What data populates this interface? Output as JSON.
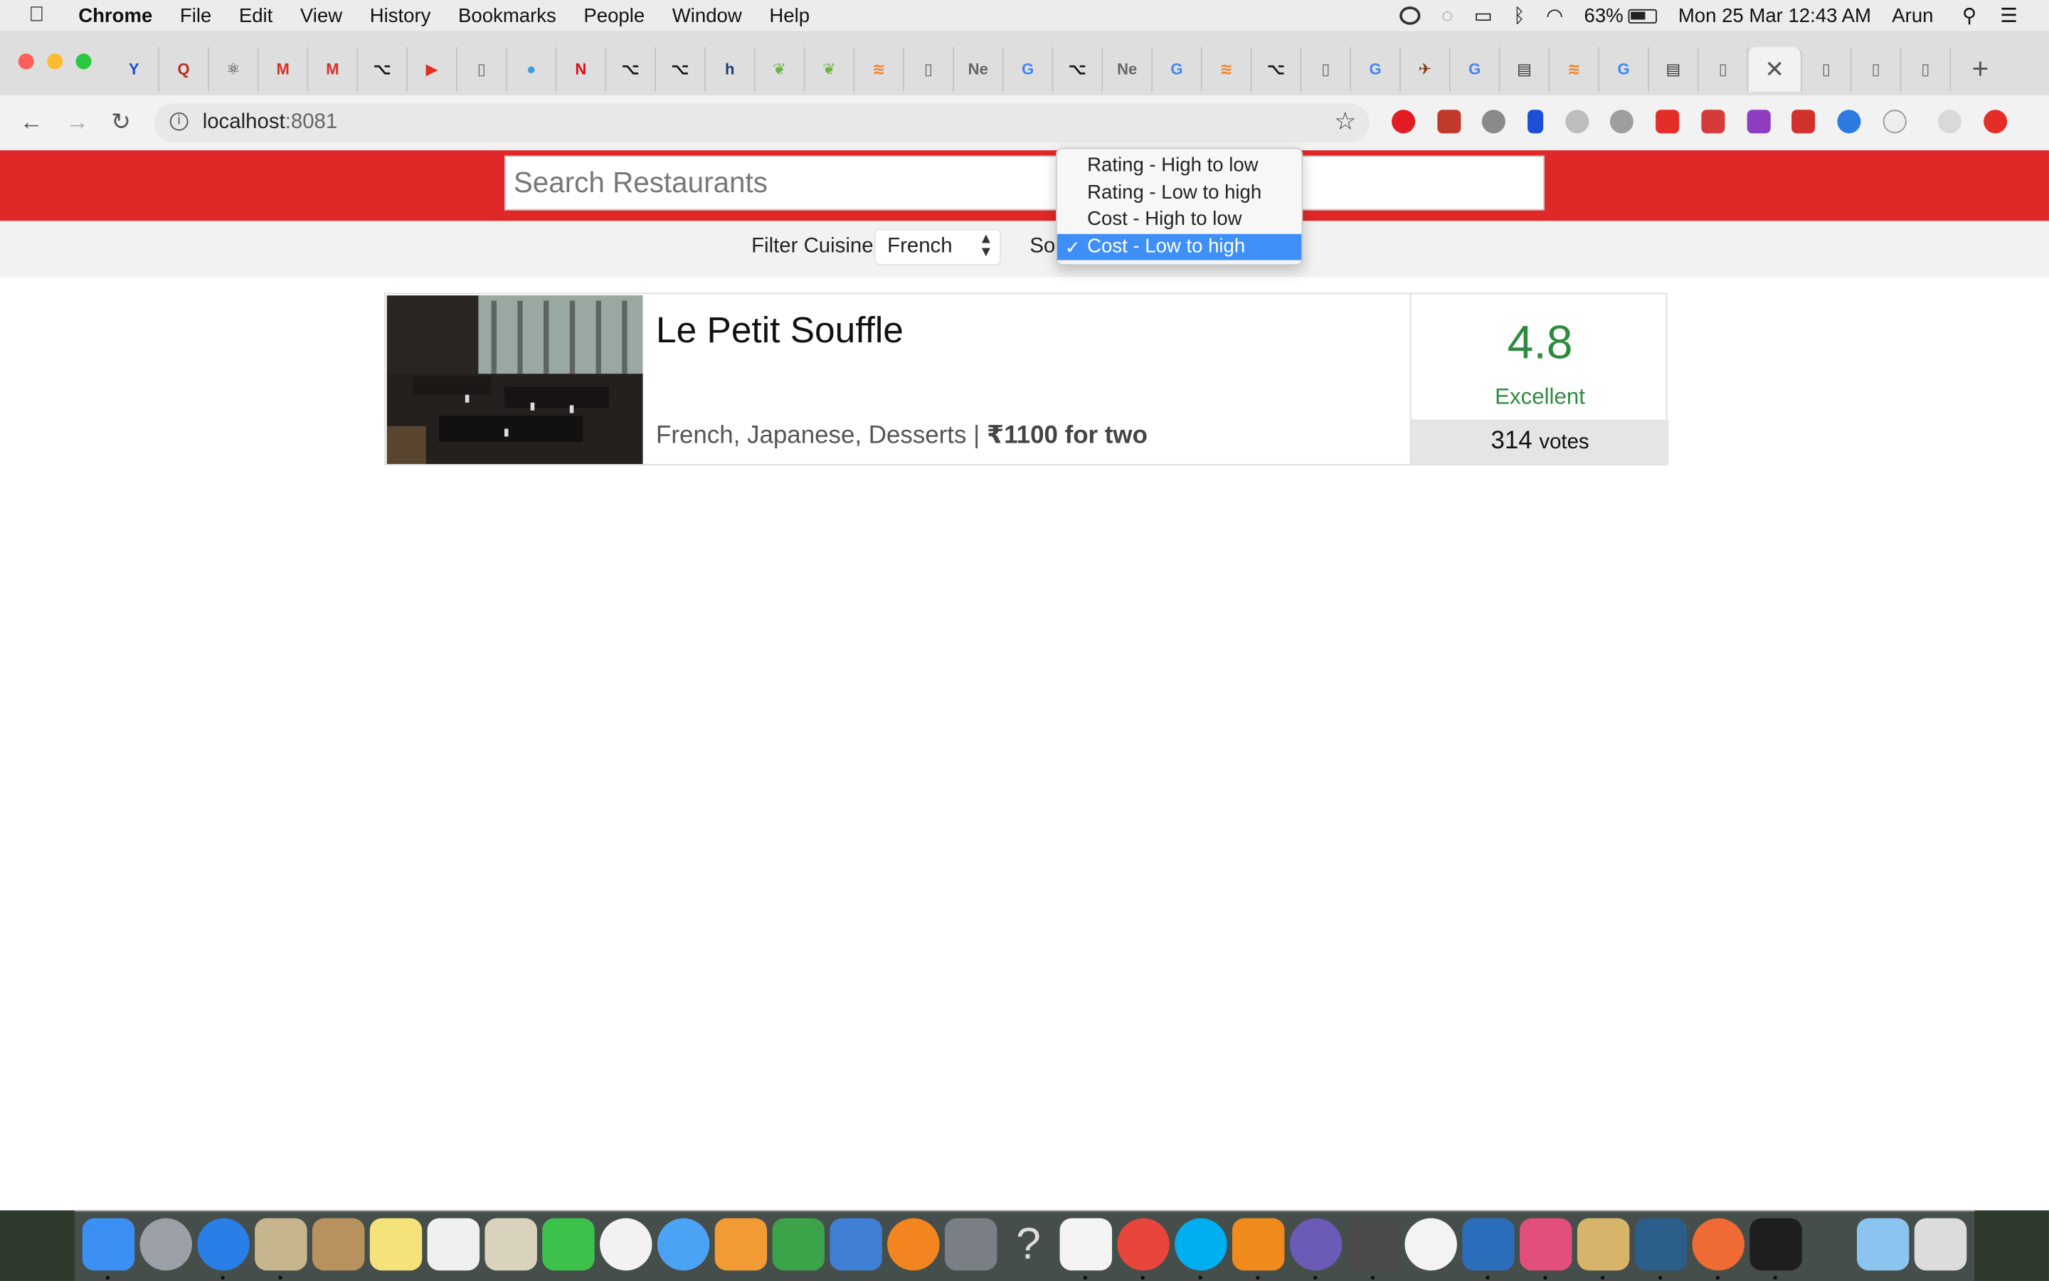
{
  "menubar": {
    "app": "Chrome",
    "items": [
      "File",
      "Edit",
      "View",
      "History",
      "Bookmarks",
      "People",
      "Window",
      "Help"
    ],
    "battery": "63%",
    "datetime": "Mon 25 Mar  12:43 AM",
    "user": "Arun"
  },
  "browser": {
    "url_host": "localhost",
    "url_port": ":8081",
    "tabs": [
      {
        "icon": "Y",
        "color": "#1a4fd6"
      },
      {
        "icon": "Q",
        "color": "#b92b27"
      },
      {
        "icon": "⚛",
        "color": "#333333"
      },
      {
        "icon": "M",
        "color": "#d93025"
      },
      {
        "icon": "M",
        "color": "#d93025"
      },
      {
        "icon": "⌥",
        "color": "#111111"
      },
      {
        "icon": "▶",
        "color": "#e52d27"
      },
      {
        "icon": "▯",
        "color": "#666666"
      },
      {
        "icon": "●",
        "color": "#3a9be0"
      },
      {
        "icon": "N",
        "color": "#e50914"
      },
      {
        "icon": "⌥",
        "color": "#111111"
      },
      {
        "icon": "⌥",
        "color": "#111111"
      },
      {
        "icon": "h",
        "color": "#1f3d70"
      },
      {
        "icon": "❦",
        "color": "#6db33f"
      },
      {
        "icon": "❦",
        "color": "#6db33f"
      },
      {
        "icon": "≋",
        "color": "#f48024"
      },
      {
        "icon": "▯",
        "color": "#666666"
      },
      {
        "icon": "Ne",
        "color": "#666666"
      },
      {
        "icon": "G",
        "color": "#4285f4"
      },
      {
        "icon": "⌥",
        "color": "#111111"
      },
      {
        "icon": "Ne",
        "color": "#666666"
      },
      {
        "icon": "G",
        "color": "#4285f4"
      },
      {
        "icon": "≋",
        "color": "#f48024"
      },
      {
        "icon": "⌥",
        "color": "#111111"
      },
      {
        "icon": "▯",
        "color": "#666666"
      },
      {
        "icon": "G",
        "color": "#4285f4"
      },
      {
        "icon": "✈",
        "color": "#7a3b12"
      },
      {
        "icon": "G",
        "color": "#4285f4"
      },
      {
        "icon": "▤",
        "color": "#333333"
      },
      {
        "icon": "≋",
        "color": "#f48024"
      },
      {
        "icon": "G",
        "color": "#4285f4"
      },
      {
        "icon": "▤",
        "color": "#333333"
      },
      {
        "icon": "▯",
        "color": "#666666"
      }
    ],
    "active_tab_close": "✕",
    "trailing_tabs": [
      {
        "icon": "▯",
        "color": "#666666"
      },
      {
        "icon": "▯",
        "color": "#666666"
      },
      {
        "icon": "▯",
        "color": "#666666"
      }
    ],
    "new_tab": "+"
  },
  "search": {
    "placeholder": "Search Restaurants"
  },
  "filters": {
    "cuisine_label": "Filter Cuisine",
    "cuisine_value": "French",
    "sort_label": "Sor"
  },
  "sort_dropdown": {
    "options": [
      "Rating - High to low",
      "Rating - Low to high",
      "Cost - High to low",
      "Cost - Low to high"
    ],
    "selected": "Cost - Low to high",
    "check": "✓"
  },
  "restaurant": {
    "name": "Le Petit Souffle",
    "cuisines": "French, Japanese, Desserts | ",
    "cost": "₹1100 for two",
    "rating": "4.8",
    "rating_text": "Excellent",
    "votes": "314",
    "votes_label": "votes",
    "rating_color": "#2e8b3e"
  },
  "colors": {
    "brand_red": "#e02828",
    "select_blue": "#3f8ff9"
  }
}
